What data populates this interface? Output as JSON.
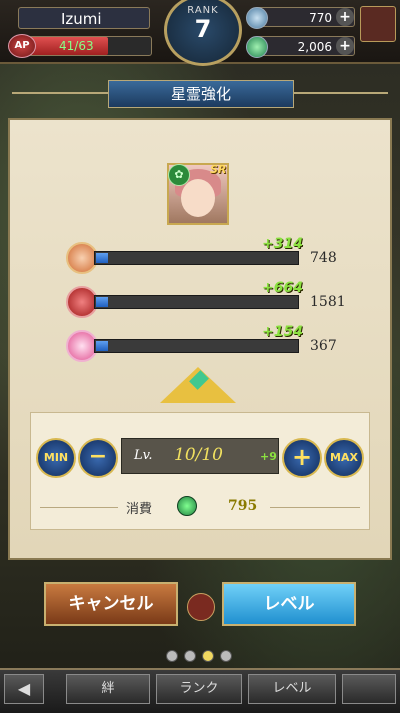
{
  "header": {
    "player_name": "Izumi",
    "ap_label": "AP",
    "ap_text": "41/63",
    "ap_fraction": 0.65,
    "rank_label": "RANK",
    "rank_value": "7",
    "currency1": "770",
    "currency2": "2,006"
  },
  "title": "星霊強化",
  "unit": {
    "rarity": "SR",
    "element_icon": "leaf-icon"
  },
  "stats": [
    {
      "icon": "attack-icon",
      "bonus": "+314",
      "value": "748",
      "fill": 0.06
    },
    {
      "icon": "hp-icon",
      "bonus": "+664",
      "value": "1581",
      "fill": 0.06
    },
    {
      "icon": "heart-icon",
      "bonus": "+154",
      "value": "367",
      "fill": 0.06
    }
  ],
  "controls": {
    "min_label": "MIN",
    "max_label": "MAX",
    "lv_label": "Lv.",
    "lv_value": "10/10",
    "lv_plus": "+9"
  },
  "consume": {
    "label": "消費",
    "value": "795"
  },
  "buttons": {
    "cancel": "キャンセル",
    "level": "レベル"
  },
  "page_dots": {
    "count": 4,
    "active": 2
  },
  "nav": {
    "tab1": "絆",
    "tab2": "ランク",
    "tab3": "レベル"
  },
  "colors": {
    "accent_gold": "#d8b850",
    "bonus_green": "#8be040",
    "bar_blue": "#2060c0"
  }
}
